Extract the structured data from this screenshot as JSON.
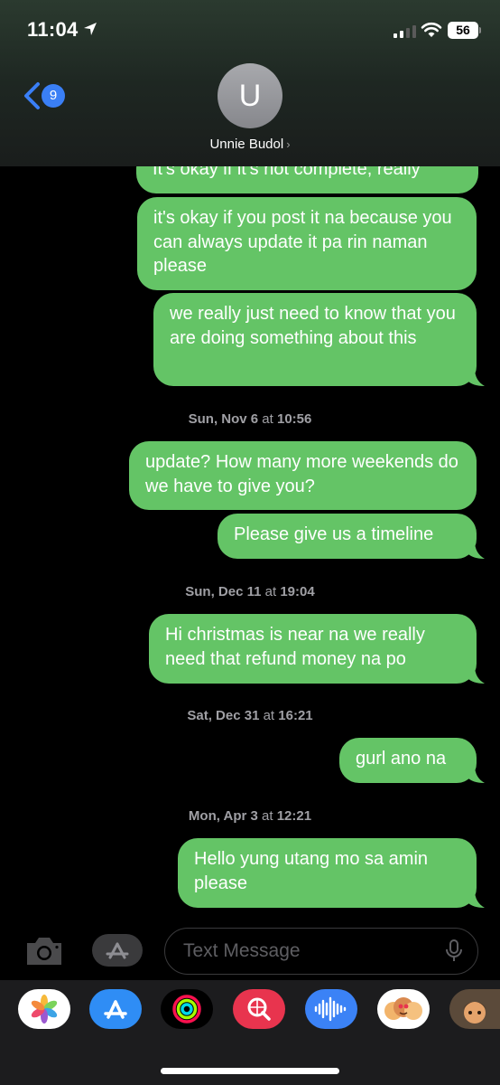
{
  "status_bar": {
    "time": "11:04",
    "battery": "56"
  },
  "header": {
    "back_badge": "9",
    "avatar_initial": "U",
    "contact_name": "Unnie Budol",
    "contact_chevron": "›"
  },
  "messages": [
    {
      "text": "It's okay if it's not complete, really"
    },
    {
      "text": "it's okay if you post it na because you can always update it pa rin naman please"
    },
    {
      "text": "we really just need to know that you are doing something about this"
    },
    {
      "text": "update? How many more weekends do we have to give you?"
    },
    {
      "text": "Please give us a timeline"
    },
    {
      "text": "Hi christmas is near na we really need that refund money na po"
    },
    {
      "text": "gurl ano na"
    },
    {
      "text": "Hello yung utang mo sa amin please"
    }
  ],
  "timestamps": [
    {
      "day": "Sun, Nov 6",
      "at": " at ",
      "time": "10:56"
    },
    {
      "day": "Sun, Dec 11",
      "at": " at ",
      "time": "19:04"
    },
    {
      "day": "Sat, Dec 31",
      "at": " at ",
      "time": "16:21"
    },
    {
      "day": "Mon, Apr 3",
      "at": " at ",
      "time": "12:21"
    }
  ],
  "input": {
    "placeholder": "Text Message"
  },
  "colors": {
    "bubble": "#64c466",
    "accent": "#3a7ff6",
    "background": "#000000"
  },
  "dock_apps": [
    "photos-app-icon",
    "app-store-app-icon",
    "fitness-app-icon",
    "search-images-app-icon",
    "audio-app-icon",
    "memoji-stickers-app-icon",
    "memoji-app-icon"
  ]
}
